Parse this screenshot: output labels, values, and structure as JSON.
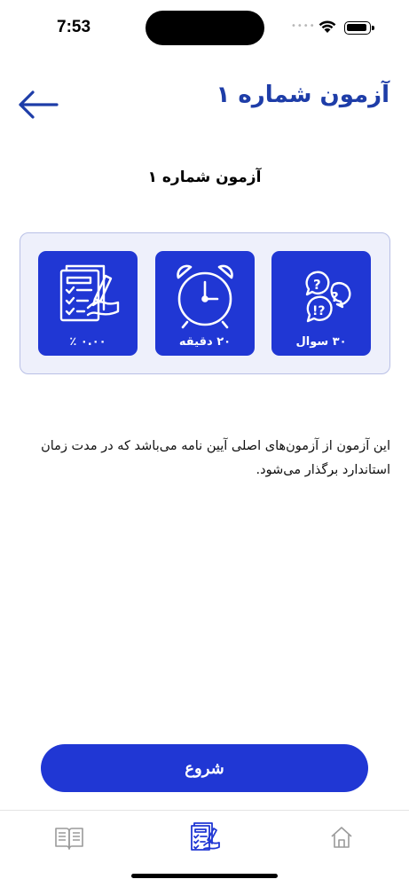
{
  "status_bar": {
    "time": "7:53"
  },
  "header": {
    "title": "آزمون شماره ۱",
    "back_icon": "arrow-left-icon"
  },
  "quiz": {
    "name": "آزمون شماره ۱",
    "stats": {
      "questions": "۳۰ سوال",
      "duration": "۲۰ دقیقه",
      "score": "۰.۰۰ ٪"
    },
    "description": "این آزمون از آزمون‌های اصلی آیین نامه می‌باشد که در مدت زمان استاندارد برگذار می‌شود."
  },
  "start_button": {
    "label": "شروع"
  },
  "tab_bar": {
    "items": [
      {
        "icon": "book-icon",
        "active": false
      },
      {
        "icon": "exam-icon",
        "active": true
      },
      {
        "icon": "home-icon",
        "active": false
      }
    ]
  },
  "colors": {
    "primary": "#2037d4",
    "title": "#1e3da8",
    "card_bg": "#eef0fb",
    "card_border": "#b9c0e6"
  }
}
